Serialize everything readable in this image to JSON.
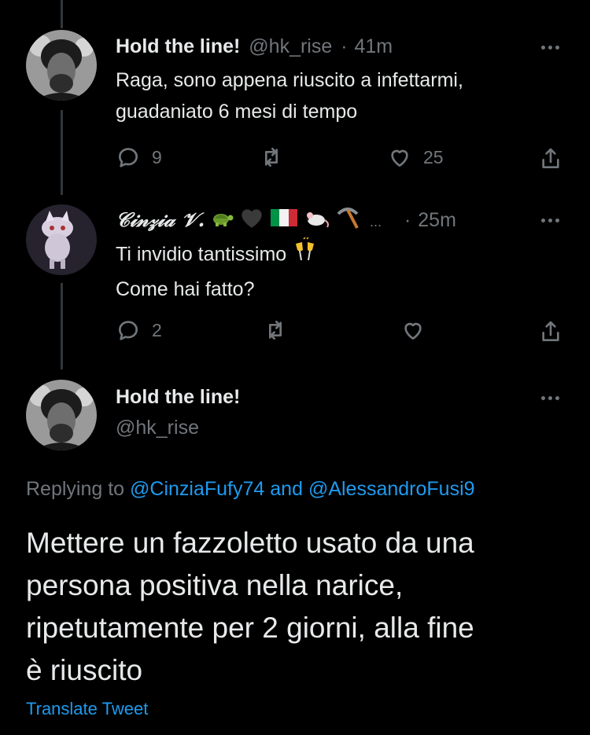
{
  "tweets": [
    {
      "display_name": "Hold the line!",
      "handle": "@hk_rise",
      "dot": "·",
      "time": "41m",
      "text_lines": [
        "Raga, sono appena riuscito a infettarmi,",
        "guadaniato 6 mesi di tempo"
      ],
      "replies": "9",
      "likes": "25"
    },
    {
      "display_name": "𝒞𝒾𝓃𝓏𝒾𝒶 𝒱.",
      "truncated": "...",
      "time_sep": "·",
      "time": "25m",
      "text_lines": [
        "Ti invidio tantissimo",
        "Come hai fatto?"
      ],
      "replies": "2"
    }
  ],
  "main_tweet": {
    "display_name": "Hold the line!",
    "handle": "@hk_rise",
    "replying_to_label": "Replying to",
    "replying_to_1": "@CinziaFufy74",
    "replying_to_and": "and",
    "replying_to_2": "@AlessandroFusi9",
    "text_lines": [
      "Mettere un fazzoletto usato da una",
      "persona positiva nella narice,",
      "ripetutamente per 2 giorni, alla fine",
      "è riuscito"
    ],
    "translate": "Translate Tweet"
  },
  "icons": [
    "reply-icon",
    "retweet-icon",
    "like-icon",
    "share-icon",
    "more-icon",
    "turtle-emoji",
    "black-heart-emoji",
    "italy-flag-emoji",
    "mouse-emoji",
    "pick-emoji",
    "clinking-glasses-emoji"
  ],
  "colors": {
    "background": "#000000",
    "text": "#e7e9ea",
    "muted": "#71767b",
    "link": "#1d9bf0",
    "thread_line": "#333639"
  }
}
